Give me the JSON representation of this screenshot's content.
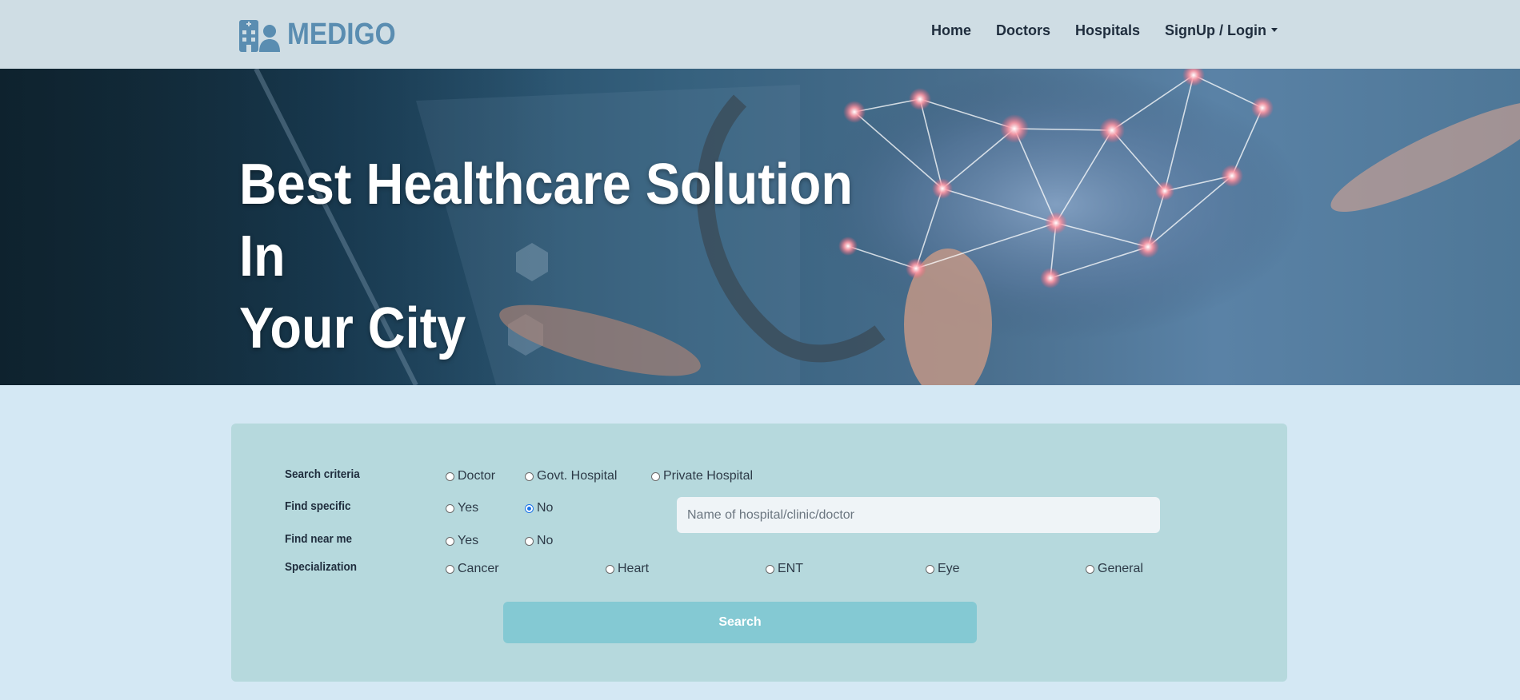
{
  "brand": {
    "name": "MEDIGO",
    "icon": "hospital-user-icon",
    "color": "#5a8db1"
  },
  "nav": {
    "home": "Home",
    "doctors": "Doctors",
    "hospitals": "Hospitals",
    "signup": "SignUp / Login"
  },
  "hero": {
    "title_line1": "Best Healthcare Solution In",
    "title_line2": "Your City"
  },
  "form": {
    "search_criteria": {
      "label": "Search criteria",
      "options": [
        "Doctor",
        "Govt. Hospital",
        "Private Hospital"
      ],
      "selected": null
    },
    "find_specific": {
      "label": "Find specific",
      "options": [
        "Yes",
        "No"
      ],
      "selected": "No"
    },
    "name_input": {
      "placeholder": "Name of hospital/clinic/doctor",
      "value": ""
    },
    "find_near_me": {
      "label": "Find near me",
      "options": [
        "Yes",
        "No"
      ],
      "selected": null
    },
    "specialization": {
      "label": "Specialization",
      "options": [
        "Cancer",
        "Heart",
        "ENT",
        "Eye",
        "General"
      ],
      "selected": null
    },
    "search_button": "Search"
  },
  "colors": {
    "navbar_bg": "#cfdde4",
    "page_bg": "#d4e8f4",
    "panel_bg": "#b6d9dd",
    "button_bg": "#84c9d3"
  }
}
